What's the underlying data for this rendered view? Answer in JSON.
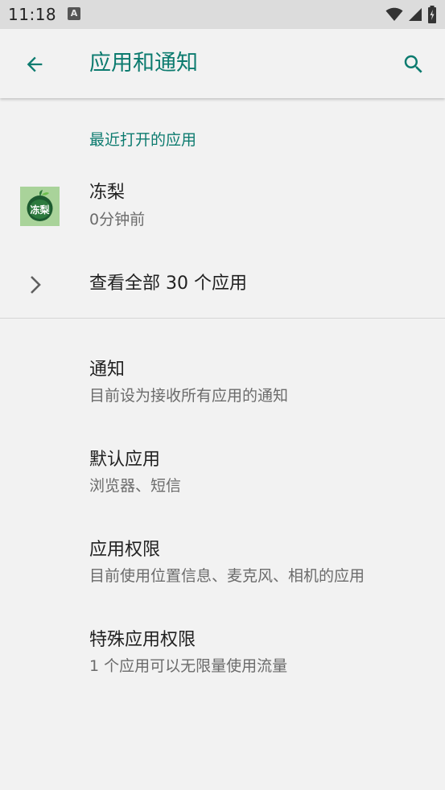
{
  "status_bar": {
    "time": "11:18",
    "notification_icon_letter": "A",
    "icons": [
      "wifi-icon",
      "cell-signal-icon",
      "battery-icon"
    ]
  },
  "app_bar": {
    "title": "应用和通知",
    "back_icon": "arrow-back-icon",
    "search_icon": "search-icon",
    "accent_color": "#0c7b6f"
  },
  "recent_apps": {
    "header": "最近打开的应用",
    "items": [
      {
        "name": "冻梨",
        "time": "0分钟前",
        "icon_label": "冻梨"
      }
    ],
    "see_all": "查看全部 30 个应用"
  },
  "settings": [
    {
      "title": "通知",
      "subtitle": "目前设为接收所有应用的通知"
    },
    {
      "title": "默认应用",
      "subtitle": "浏览器、短信"
    },
    {
      "title": "应用权限",
      "subtitle": "目前使用位置信息、麦克风、相机的应用"
    },
    {
      "title": "特殊应用权限",
      "subtitle": "1 个应用可以无限量使用流量"
    }
  ]
}
